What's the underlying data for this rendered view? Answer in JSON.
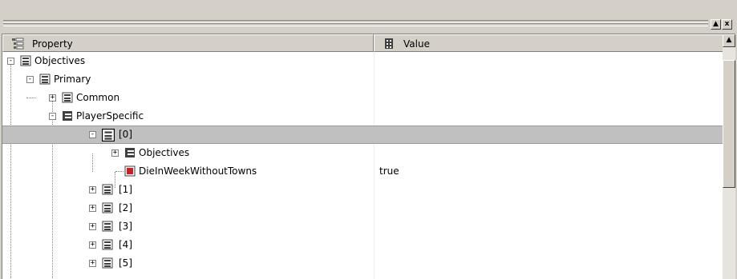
{
  "window": {
    "restore_glyph": "▲",
    "close_glyph": "x"
  },
  "header": {
    "property_label": "Property",
    "value_label": "Value"
  },
  "scrollbar": {
    "up_glyph": "▲"
  },
  "tree": {
    "rows": [
      {
        "label": "Objectives",
        "value": "",
        "icon": "list-icon",
        "expander": "-"
      },
      {
        "label": "Primary",
        "value": "",
        "icon": "list-icon",
        "expander": "-"
      },
      {
        "label": "Common",
        "value": "",
        "icon": "list-icon",
        "expander": "+"
      },
      {
        "label": "PlayerSpecific",
        "value": "",
        "icon": "folder-list-icon",
        "expander": "-"
      },
      {
        "label": "[0]",
        "value": "",
        "icon": "list-icon",
        "expander": "-",
        "selected": true
      },
      {
        "label": "Objectives",
        "value": "",
        "icon": "folder-list-icon",
        "expander": "+"
      },
      {
        "label": "DieInWeekWithoutTowns",
        "value": "true",
        "icon": "red-checkbox-icon",
        "expander": ""
      },
      {
        "label": "[1]",
        "value": "",
        "icon": "list-icon",
        "expander": "+"
      },
      {
        "label": "[2]",
        "value": "",
        "icon": "list-icon",
        "expander": "+"
      },
      {
        "label": "[3]",
        "value": "",
        "icon": "list-icon",
        "expander": "+"
      },
      {
        "label": "[4]",
        "value": "",
        "icon": "list-icon",
        "expander": "+"
      },
      {
        "label": "[5]",
        "value": "",
        "icon": "list-icon",
        "expander": "+"
      }
    ]
  }
}
